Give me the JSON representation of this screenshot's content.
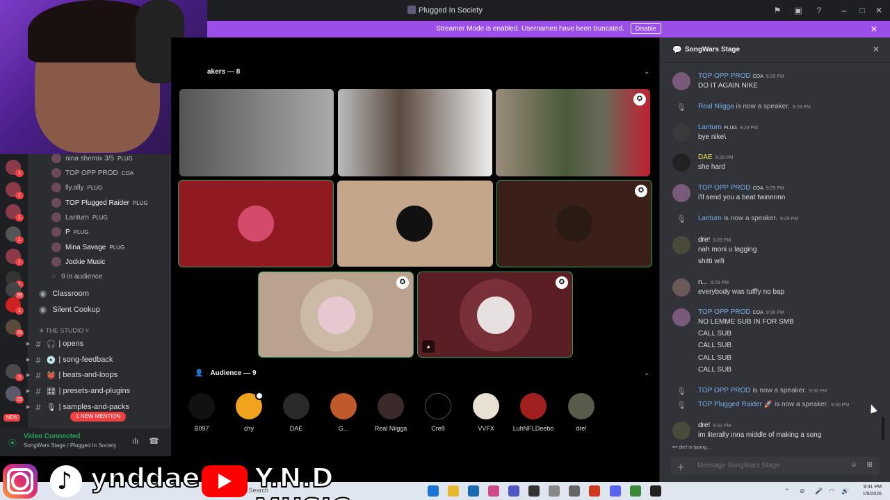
{
  "window": {
    "title": "Plugged In Society"
  },
  "banner": {
    "text": "Streamer Mode is enabled. Usernames have been truncated.",
    "button": "Disable"
  },
  "sidebar": {
    "guild_badges": [
      "1",
      "1",
      "1",
      "1",
      "1",
      "1",
      "58",
      "1",
      "15",
      "3",
      "29"
    ],
    "new_badge": "NEW",
    "voice_members": [
      {
        "name": "nina shemix 3/5",
        "tag": "PLUG"
      },
      {
        "name": "TOP OPP PROD",
        "tag": "COA"
      },
      {
        "name": "lly.ally",
        "tag": "PLUG"
      },
      {
        "name": "TOP Plugged Raider",
        "tag": "PLUG"
      },
      {
        "name": "Lanturn",
        "tag": "PLUG"
      },
      {
        "name": "P",
        "tag": "PLUG"
      },
      {
        "name": "Mina Savage",
        "tag": "PLUG"
      },
      {
        "name": "Jockie Music",
        "tag": ""
      }
    ],
    "audience_count": "9 in audience",
    "voice_channels": [
      "Classroom",
      "Silent Cookup"
    ],
    "category": "THE STUDIO",
    "text_channels": [
      "| opens",
      "| song-feedback",
      "| beats-and-loops",
      "| presets-and-plugins",
      "| samples-and-packs"
    ],
    "new_mention": "1 NEW MENTION",
    "voice_status": {
      "connected": "Video Connected",
      "location": "SongWars Stage / Plugged In Society"
    }
  },
  "stage": {
    "speakers_header": "akers — 8",
    "audience_header": "Audience — 9",
    "audience": [
      "B097",
      "chy",
      "DAE",
      "G...",
      "Real Niigga",
      "Cre8",
      "VVFX",
      "LuhNFLDeebo",
      "dre!"
    ]
  },
  "chat": {
    "title": "SongWars Stage",
    "messages": [
      {
        "name": "TOP OPP PROD",
        "badge": "COA",
        "time": "9:29 PM",
        "lines": [
          "DO IT AGAIN NIKE"
        ]
      },
      {
        "system": true,
        "name": "Real Niigga",
        "text": "is now a speaker.",
        "time": "9:29 PM"
      },
      {
        "name": "Lanturn",
        "badge": "PLUG",
        "time": "9:29 PM",
        "lines": [
          "bye nike\\"
        ]
      },
      {
        "name": "DAE",
        "badge": "",
        "time": "9:29 PM",
        "lines": [
          "she hard"
        ]
      },
      {
        "name": "TOP OPP PROD",
        "badge": "COA",
        "time": "9:29 PM",
        "lines": [
          "i'll send you a beat twinnnnn"
        ]
      },
      {
        "system": true,
        "name": "Lanturn",
        "text": "is now a speaker.",
        "time": "9:29 PM"
      },
      {
        "name": "dre!",
        "badge": "",
        "time": "9:29 PM",
        "lines": [
          "nah moni u lagging",
          "shitti wifi"
        ]
      },
      {
        "name": "n...",
        "badge": "",
        "time": "9:29 PM",
        "lines": [
          "everybody was tufffy no bap"
        ]
      },
      {
        "name": "TOP OPP PROD",
        "badge": "COA",
        "time": "9:30 PM",
        "lines": [
          "NO LEMME SUB IN FOR SMB",
          "CALL SUB",
          "CALL SUB",
          "CALL SUB",
          "CALL SUB"
        ]
      },
      {
        "system": true,
        "name": "TOP OPP PROD",
        "text": "is now a speaker.",
        "time": "9:30 PM"
      },
      {
        "system": true,
        "name": "TOP Plugged Raider",
        "text": "is now a speaker.",
        "time": "9:30 PM"
      },
      {
        "name": "dre!",
        "badge": "",
        "time": "9:31 PM",
        "lines": [
          "im literally inna middle of making a song"
        ]
      }
    ],
    "typing": "dre! is typing...",
    "placeholder": "Message SongWars Stage"
  },
  "taskbar": {
    "search": "Search",
    "time": "9:31 PM",
    "date": "1/9/2026"
  },
  "overlay": {
    "tiktok_handle": "ynddae",
    "youtube_handle": "Y.N.D MUSIC"
  }
}
